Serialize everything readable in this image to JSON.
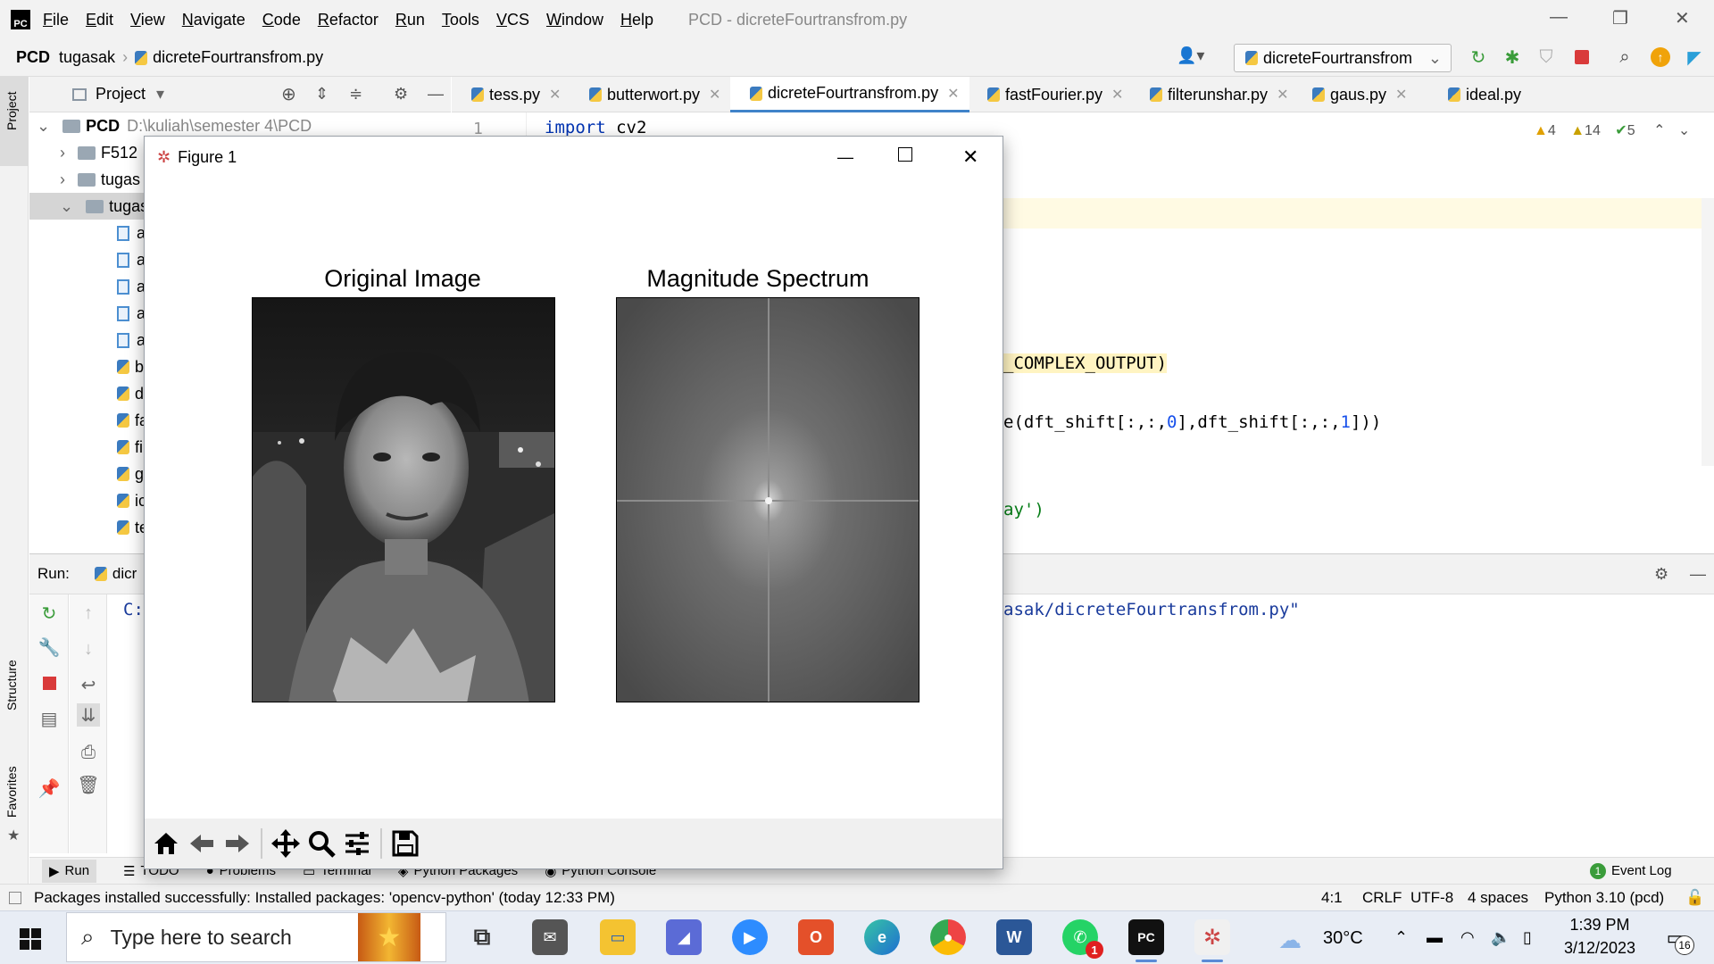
{
  "menubar": {
    "items": [
      "File",
      "Edit",
      "View",
      "Navigate",
      "Code",
      "Refactor",
      "Run",
      "Tools",
      "VCS",
      "Window",
      "Help"
    ],
    "window_title": "PCD - dicreteFourtransfrom.py"
  },
  "navbar": {
    "root": "PCD",
    "folder": "tugasak",
    "file": "dicreteFourtransfrom.py",
    "run_config": "dicreteFourtransfrom"
  },
  "sidebar_labels": {
    "project": "Project",
    "structure": "Structure",
    "favorites": "Favorites"
  },
  "project_panel": {
    "title": "Project",
    "root_label": "PCD",
    "root_path": "D:\\kuliah\\semester 4\\PCD",
    "rows": [
      "F512",
      "tugas",
      "tugas",
      "a",
      "a",
      "a",
      "a",
      "a",
      "b",
      "d",
      "fa",
      "fi",
      "g",
      "ic",
      "te"
    ]
  },
  "editor_tabs": [
    "tess.py",
    "butterwort.py",
    "dicreteFourtransfrom.py",
    "fastFourier.py",
    "filterunshar.py",
    "gaus.py",
    "ideal.py"
  ],
  "editor": {
    "line_number": "1",
    "line1_kw": "import",
    "line1_rest": " cv2",
    "frag_complex": "_COMPLEX_OUTPUT)",
    "frag_magnitude_a": "e(dft_shift[:,:,",
    "frag_magnitude_b": "0",
    "frag_magnitude_c": "],dft_shift[:,:,",
    "frag_magnitude_d": "1",
    "frag_magnitude_e": "]))",
    "frag_gray": "ay')",
    "inspections": {
      "warnings": "4",
      "weak_warnings": "14",
      "ok": "5"
    }
  },
  "run_panel": {
    "label": "Run:",
    "tab": "dicr",
    "output_start": "C:",
    "output_end": "asak/dicreteFourtransfrom.py\""
  },
  "figure": {
    "window_title": "Figure 1",
    "subplots": [
      {
        "title": "Original Image"
      },
      {
        "title": "Magnitude Spectrum"
      }
    ],
    "toolbar": [
      "home-icon",
      "back-icon",
      "forward-icon",
      "pan-icon",
      "zoom-icon",
      "configure-subplots-icon",
      "save-icon"
    ]
  },
  "toolwindows": [
    "Run",
    "TODO",
    "Problems",
    "Terminal",
    "Python Packages",
    "Python Console"
  ],
  "event_log": "Event Log",
  "status": {
    "message": "Packages installed successfully: Installed packages: 'opencv-python' (today 12:33 PM)",
    "position": "4:1",
    "line_sep": "CRLF",
    "encoding": "UTF-8",
    "indent": "4 spaces",
    "interpreter": "Python 3.10 (pcd)"
  },
  "taskbar": {
    "search_placeholder": "Type here to search",
    "weather": "30°C",
    "time": "1:39 PM",
    "date": "3/12/2023",
    "notification_count": "16",
    "whatsapp_badge": "1"
  },
  "colors": {
    "accent": "#4083c9",
    "keyword": "#0033b3",
    "number": "#1750eb",
    "string": "#067d17",
    "highlight": "#fffae3"
  }
}
